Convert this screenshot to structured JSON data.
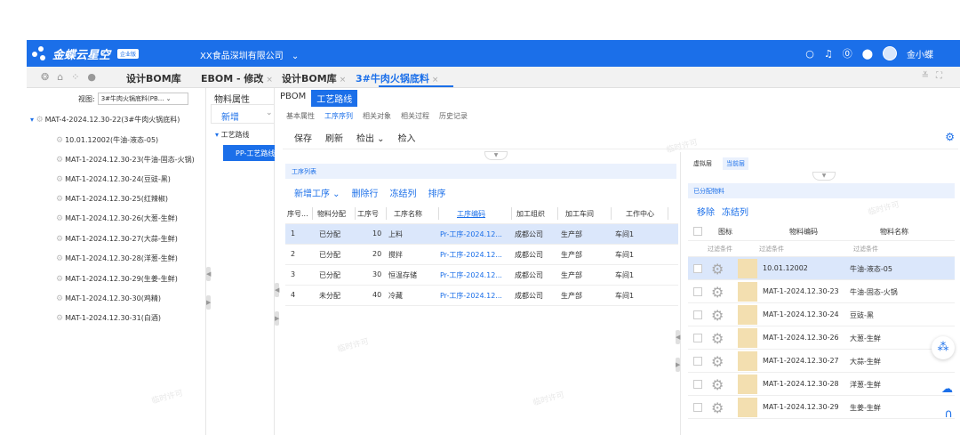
{
  "topbar": {
    "brand": "金蝶云星空",
    "brand_badge": "企业版",
    "company": "XX食品深圳有限公司",
    "company_caret": "⌄",
    "user": "金小蝶"
  },
  "tabs": [
    {
      "label": "设计BOM库"
    },
    {
      "label": "EBOM - 修改"
    },
    {
      "label": "设计BOM库"
    },
    {
      "label": "3#牛肉火锅底料"
    }
  ],
  "left": {
    "view_label": "视图:",
    "view_value": "3#牛肉火锅底料(PB...",
    "root": "MAT-4-2024.12.30-22(3#牛肉火锅底料)",
    "items": [
      "10.01.12002(牛油-液态-05)",
      "MAT-1-2024.12.30-23(牛油-固态-火锅)",
      "MAT-1-2024.12.30-24(豆豉-黑)",
      "MAT-1-2024.12.30-25(红辣椒)",
      "MAT-1-2024.12.30-26(大葱-生鲜)",
      "MAT-1-2024.12.30-27(大蒜-生鲜)",
      "MAT-1-2024.12.30-28(洋葱-生鲜)",
      "MAT-1-2024.12.30-29(生姜-生鲜)",
      "MAT-1-2024.12.30-30(鸡精)",
      "MAT-1-2024.12.30-31(白酒)"
    ]
  },
  "mid": {
    "tab": "物料属性",
    "add": "新增",
    "route": "工艺路线",
    "selected": "PP-工艺路线-"
  },
  "main": {
    "tabs": [
      "PBOM",
      "工艺路线"
    ],
    "subtabs": [
      "基本属性",
      "工序序列",
      "相关对象",
      "相关过程",
      "历史记录"
    ],
    "toolbar": [
      "保存",
      "刷新",
      "检出 ⌄",
      "检入"
    ],
    "list_title": "工序列表",
    "list_tools": [
      "新增工序 ⌄",
      "删除行",
      "冻结列",
      "排序"
    ],
    "columns": [
      "序号...",
      "物料分配",
      "工序号",
      "工序名称",
      "工序编码",
      "加工组织",
      "加工车间",
      "工作中心"
    ],
    "rows": [
      [
        "1",
        "已分配",
        "10",
        "上料",
        "Pr-工序-2024.12...",
        "成都公司",
        "生产部",
        "车间1"
      ],
      [
        "2",
        "已分配",
        "20",
        "搅拌",
        "Pr-工序-2024.12...",
        "成都公司",
        "生产部",
        "车间1"
      ],
      [
        "3",
        "已分配",
        "30",
        "恒温存储",
        "Pr-工序-2024.12...",
        "成都公司",
        "生产部",
        "车间1"
      ],
      [
        "4",
        "未分配",
        "40",
        "冷藏",
        "Pr-工序-2024.12...",
        "成都公司",
        "生产部",
        "车间1"
      ]
    ]
  },
  "right": {
    "tabs": [
      "虚拟层",
      "当前层"
    ],
    "title": "已分配物料",
    "tools": [
      "移除",
      "冻结列"
    ],
    "columns": [
      "图标",
      "物料编码",
      "物料名称"
    ],
    "filter": "过滤条件",
    "rows": [
      [
        "10.01.12002",
        "牛油-液态-05"
      ],
      [
        "MAT-1-2024.12.30-23",
        "牛油-固态-火锅"
      ],
      [
        "MAT-1-2024.12.30-24",
        "豆豉-黑"
      ],
      [
        "MAT-1-2024.12.30-26",
        "大葱-生鲜"
      ],
      [
        "MAT-1-2024.12.30-27",
        "大蒜-生鲜"
      ],
      [
        "MAT-1-2024.12.30-28",
        "洋葱-生鲜"
      ],
      [
        "MAT-1-2024.12.30-29",
        "生姜-生鲜"
      ]
    ]
  },
  "watermark": "临时许可"
}
